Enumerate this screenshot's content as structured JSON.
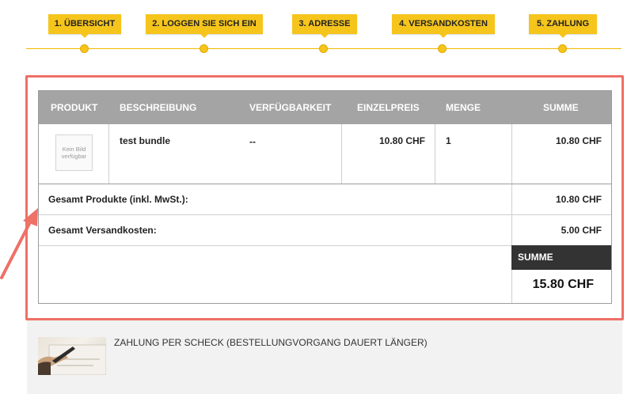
{
  "steps": [
    {
      "label": "1. ÜBERSICHT"
    },
    {
      "label": "2. LOGGEN SIE SICH EIN"
    },
    {
      "label": "3. ADRESSE"
    },
    {
      "label": "4. VERSANDKOSTEN"
    },
    {
      "label": "5. ZAHLUNG"
    }
  ],
  "cart": {
    "headers": {
      "product": "PRODUKT",
      "description": "BESCHREIBUNG",
      "availability": "VERFÜGBARKEIT",
      "unit_price": "EINZELPREIS",
      "quantity": "MENGE",
      "total": "SUMME"
    },
    "items": [
      {
        "image_text": "Kein Bild verfügbar",
        "description": "test bundle",
        "availability": "--",
        "unit_price": "10.80 CHF",
        "quantity": "1",
        "total": "10.80 CHF"
      }
    ],
    "totals": {
      "products_label": "Gesamt Produkte (inkl. MwSt.):",
      "products_value": "10.80 CHF",
      "shipping_label": "Gesamt Versandkosten:",
      "shipping_value": "5.00 CHF",
      "sum_label": "SUMME",
      "sum_value": "15.80 CHF"
    }
  },
  "payment": {
    "option_label": "ZAHLUNG PER SCHECK (BESTELLUNGVORGANG DAUERT LÄNGER)"
  },
  "colors": {
    "step_yellow": "#f6c51c",
    "highlight_red": "#ee7066",
    "table_header_gray": "#a4a4a4",
    "sum_header_dark": "#333333"
  }
}
